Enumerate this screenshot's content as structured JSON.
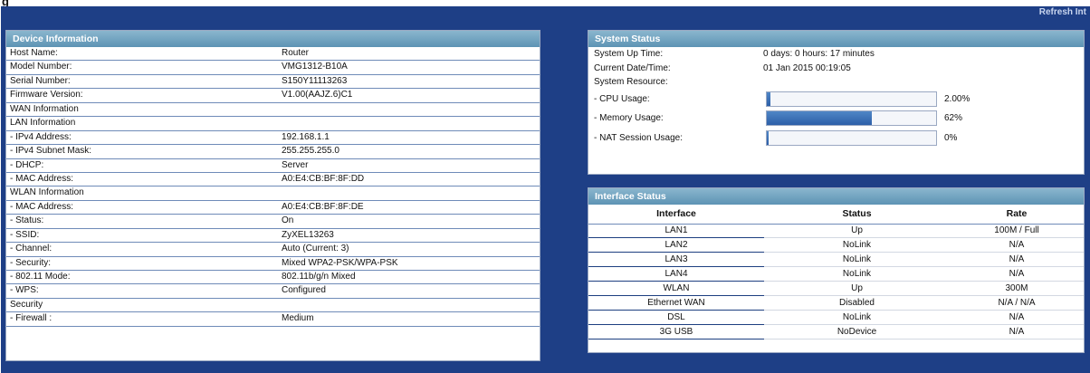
{
  "figure_label": "g",
  "refresh_label": "Refresh Int",
  "device_info": {
    "title": "Device Information",
    "rows": [
      {
        "label": "Host Name:",
        "value": "Router"
      },
      {
        "label": "Model Number:",
        "value": "VMG1312-B10A"
      },
      {
        "label": "Serial Number:",
        "value": "S150Y11113263"
      },
      {
        "label": "Firmware Version:",
        "value": "V1.00(AAJZ.6)C1"
      },
      {
        "label": "WAN Information",
        "value": ""
      },
      {
        "label": "LAN Information",
        "value": ""
      },
      {
        "label": " - IPv4 Address:",
        "value": "192.168.1.1"
      },
      {
        "label": " - IPv4 Subnet Mask:",
        "value": "255.255.255.0"
      },
      {
        "label": " - DHCP:",
        "value": "Server"
      },
      {
        "label": " - MAC Address:",
        "value": "A0:E4:CB:BF:8F:DD"
      },
      {
        "label": "WLAN Information",
        "value": ""
      },
      {
        "label": " - MAC Address:",
        "value": "A0:E4:CB:BF:8F:DE"
      },
      {
        "label": " - Status:",
        "value": "On"
      },
      {
        "label": " - SSID:",
        "value": "ZyXEL13263"
      },
      {
        "label": " - Channel:",
        "value": "Auto (Current: 3)"
      },
      {
        "label": " - Security:",
        "value": "Mixed WPA2-PSK/WPA-PSK"
      },
      {
        "label": " - 802.11 Mode:",
        "value": "802.11b/g/n Mixed"
      },
      {
        "label": " - WPS:",
        "value": "Configured"
      },
      {
        "label": "Security",
        "value": ""
      },
      {
        "label": " - Firewall :",
        "value": "Medium"
      }
    ]
  },
  "system_status": {
    "title": "System Status",
    "up_time_label": "System Up Time:",
    "up_time_value": "0 days: 0 hours: 17 minutes",
    "datetime_label": "Current Date/Time:",
    "datetime_value": "01 Jan 2015 00:19:05",
    "resource_label": "System Resource:",
    "resources": [
      {
        "label": " - CPU Usage:",
        "percent_text": "2.00%",
        "fraction": 0.02
      },
      {
        "label": " - Memory Usage:",
        "percent_text": "62%",
        "fraction": 0.62
      },
      {
        "label": " - NAT Session Usage:",
        "percent_text": "0%",
        "fraction": 0.0
      }
    ]
  },
  "interface_status": {
    "title": "Interface Status",
    "headers": [
      "Interface",
      "Status",
      "Rate"
    ],
    "rows": [
      {
        "interface": "LAN1",
        "status": "Up",
        "rate": "100M / Full"
      },
      {
        "interface": "LAN2",
        "status": "NoLink",
        "rate": "N/A"
      },
      {
        "interface": "LAN3",
        "status": "NoLink",
        "rate": "N/A"
      },
      {
        "interface": "LAN4",
        "status": "NoLink",
        "rate": "N/A"
      },
      {
        "interface": "WLAN",
        "status": "Up",
        "rate": "300M"
      },
      {
        "interface": "Ethernet WAN",
        "status": "Disabled",
        "rate": "N/A / N/A"
      },
      {
        "interface": "DSL",
        "status": "NoLink",
        "rate": "N/A"
      },
      {
        "interface": "3G USB",
        "status": "NoDevice",
        "rate": "N/A"
      }
    ]
  },
  "colors": {
    "background": "#1e3f86",
    "header_gradient_top": "#8ab6ce",
    "header_gradient_bottom": "#5d93b4",
    "bar_fill": "#3a6fb8"
  }
}
